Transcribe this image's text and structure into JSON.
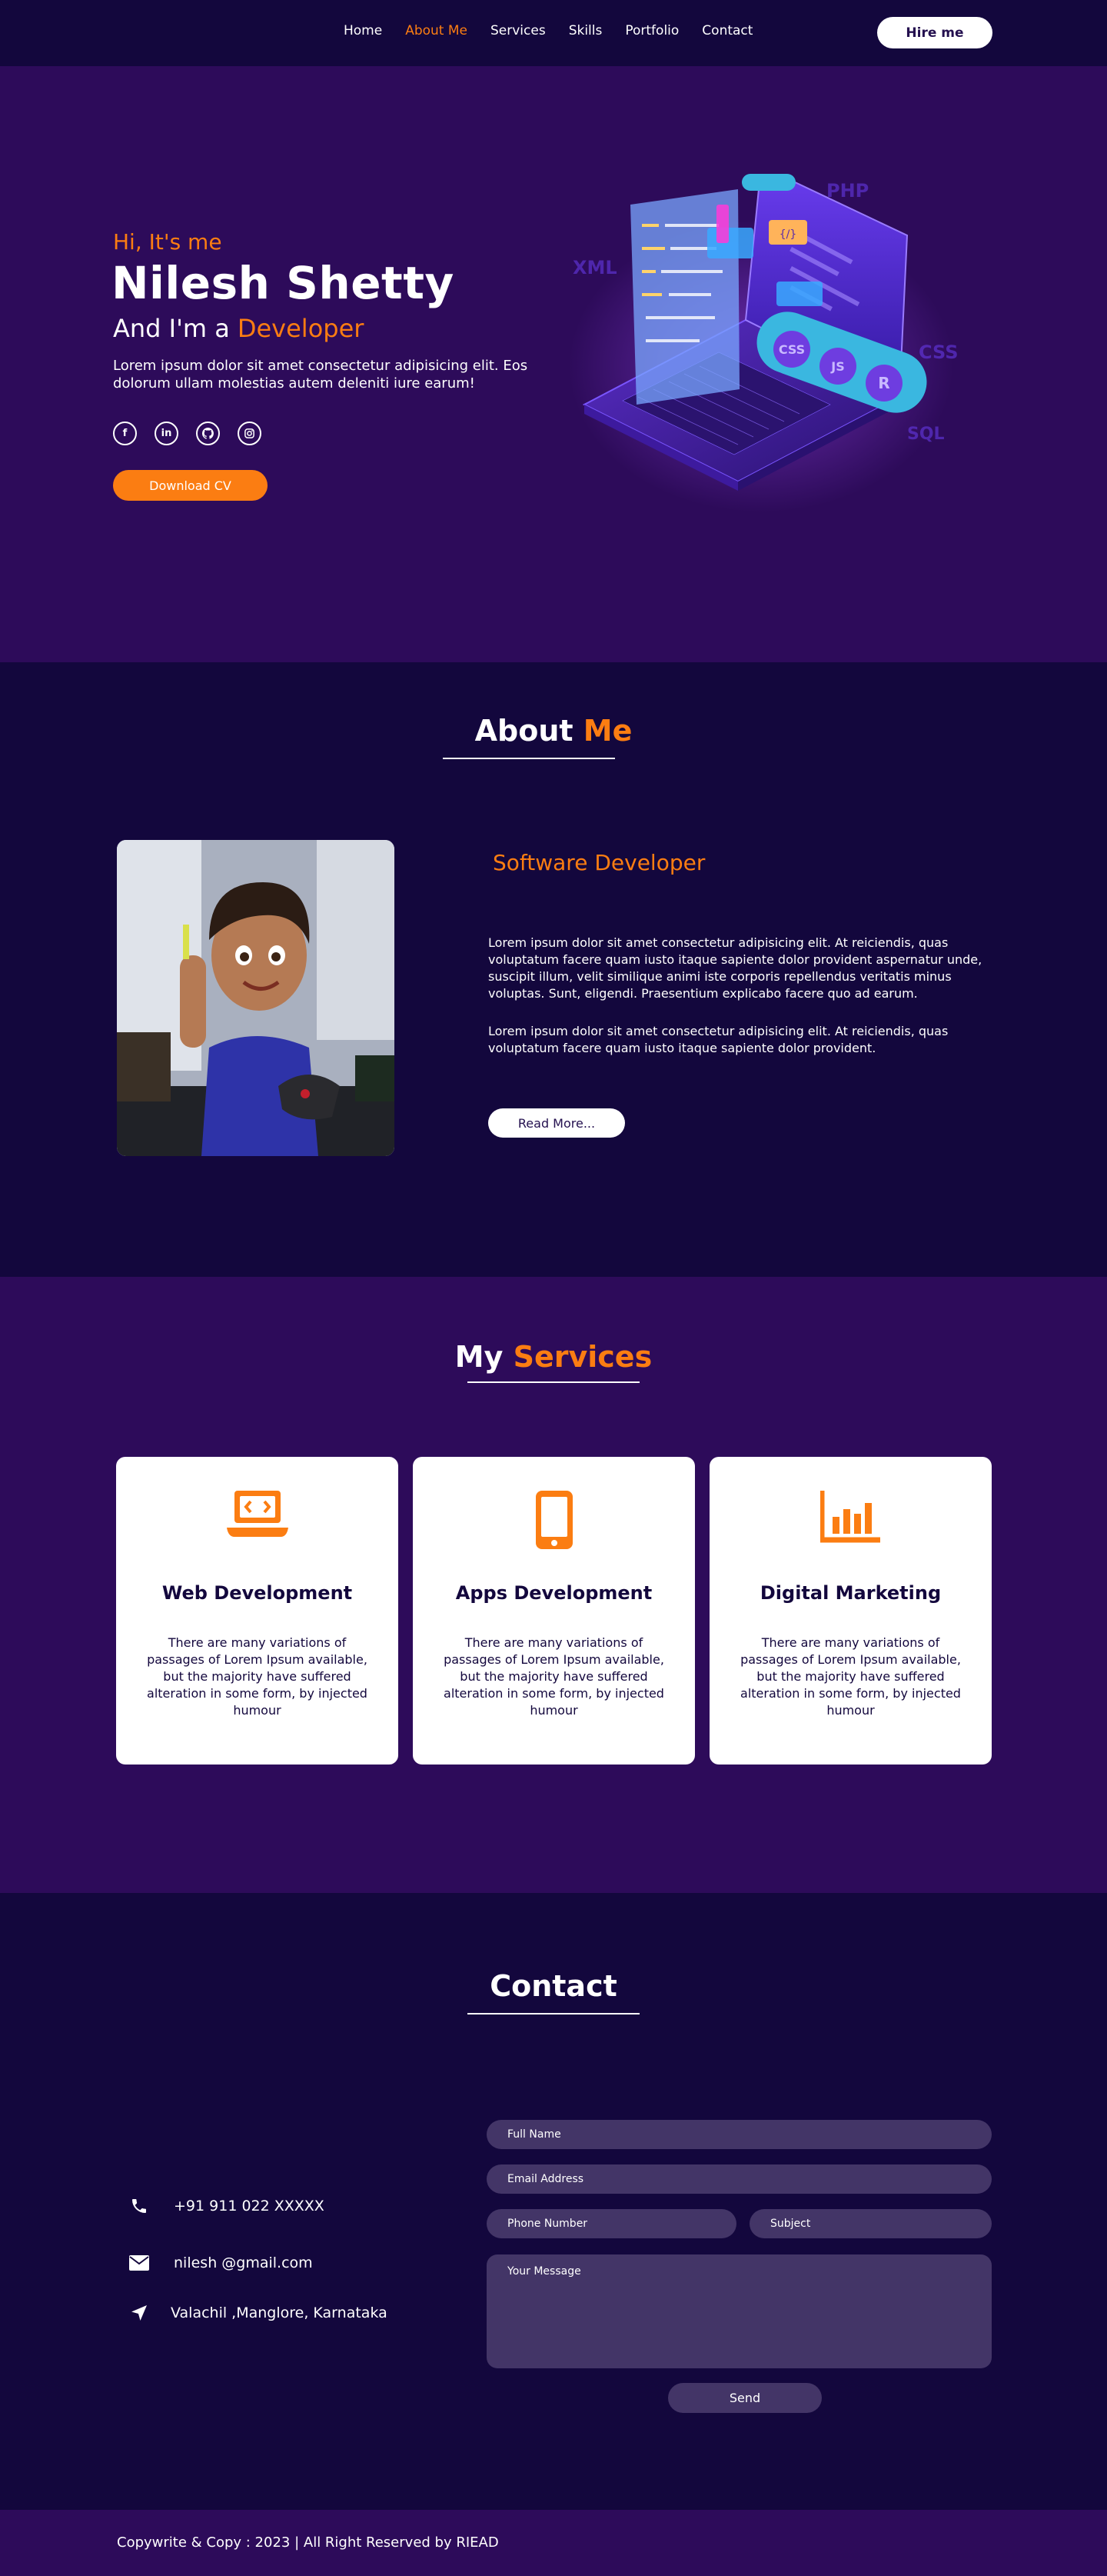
{
  "nav": {
    "links": [
      "Home",
      "About Me",
      "Services",
      "Skills",
      "Portfolio",
      "Contact"
    ],
    "active_index": 1,
    "hire_label": "Hire me"
  },
  "hero": {
    "greeting": "Hi, It's me",
    "name": "Nilesh Shetty",
    "role_prefix": "And I'm a",
    "role_highlight": "Developer",
    "description": "Lorem ipsum dolor sit amet consectetur adipisicing elit. Eos dolorum ullam molestias autem deleniti iure earum!",
    "socials": [
      "facebook-icon",
      "linkedin-icon",
      "github-icon",
      "instagram-icon"
    ],
    "download_label": "Download CV",
    "art_tags": [
      "PHP",
      "XML",
      "CSS",
      "JS",
      "R",
      "SQL"
    ]
  },
  "about": {
    "title_plain": "About",
    "title_highlight": "Me",
    "subtitle": "Software  Developer",
    "paragraph1": "Lorem ipsum dolor sit amet consectetur adipisicing elit. At reiciendis, quas voluptatum facere quam iusto itaque sapiente dolor provident aspernatur unde, suscipit illum, velit similique animi iste corporis repellendus veritatis minus voluptas. Sunt, eligendi. Praesentium explicabo facere quo ad earum.",
    "paragraph2": "Lorem ipsum dolor sit amet consectetur adipisicing elit. At reiciendis, quas voluptatum facere quam iusto itaque sapiente dolor provident.",
    "read_more_label": "Read More..."
  },
  "services": {
    "title_plain": "My",
    "title_highlight": "Services",
    "cards": [
      {
        "icon": "laptop-code-icon",
        "title": "Web Development",
        "desc": "There are many variations of passages of Lorem Ipsum available, but the majority have suffered alteration in some form, by injected humour"
      },
      {
        "icon": "mobile-phone-icon",
        "title": "Apps Development",
        "desc": "There are many variations of passages of Lorem Ipsum available, but the majority have suffered alteration in some form, by injected humour"
      },
      {
        "icon": "bar-chart-icon",
        "title": "Digital Marketing",
        "desc": "There are many variations of passages of Lorem Ipsum available, but the majority have suffered alteration in some form, by injected humour"
      }
    ]
  },
  "contact": {
    "title": "Contact",
    "phone": "+91 911 022 XXXXX",
    "email": "nilesh @gmail.com",
    "address": "Valachil ,Manglore, Karnataka",
    "fields": {
      "full_name": "Full Name",
      "email": "Email Address",
      "phone": "Phone Number",
      "subject": "Subject",
      "message": "Your Message"
    },
    "send_label": "Send"
  },
  "footer": {
    "text": "Copywrite & Copy : 2023 | All Right Reserved by RIEAD"
  },
  "colors": {
    "accent": "#fb7d12",
    "dark_bg": "#13073d",
    "purple_bg": "#2d0b5a",
    "field_bg": "#433567"
  }
}
